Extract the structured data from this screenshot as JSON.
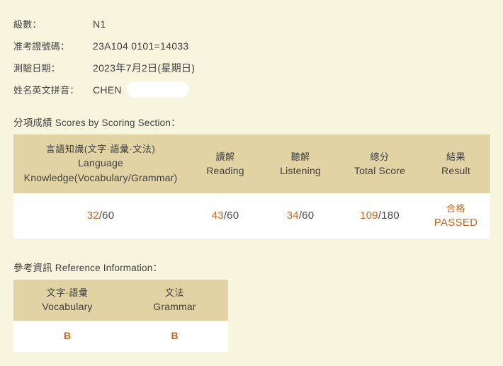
{
  "info": {
    "rows": [
      {
        "label": "級數：",
        "value": "N1"
      },
      {
        "label": "准考證號碼：",
        "value": "23A104 0101=14033"
      },
      {
        "label": "測驗日期：",
        "value": "2023年7月2日(星期日)"
      },
      {
        "label": "姓名英文拼音：",
        "value": "CHEN",
        "redacted": true
      }
    ]
  },
  "scores_section": {
    "caption": "分項成績 Scores by Scoring Section：",
    "columns": [
      {
        "cn": "言語知識(文字·語彙·文法)",
        "en_line1": "Language",
        "en_line2": "Knowledge(Vocabulary/Grammar)"
      },
      {
        "cn": "讀解",
        "en_line1": "Reading"
      },
      {
        "cn": "聽解",
        "en_line1": "Listening"
      },
      {
        "cn": "總分",
        "en_line1": "Total Score"
      },
      {
        "cn": "結果",
        "en_line1": "Result"
      }
    ],
    "values": [
      {
        "num": "32",
        "den": "/60"
      },
      {
        "num": "43",
        "den": "/60"
      },
      {
        "num": "34",
        "den": "/60"
      },
      {
        "num": "109",
        "den": "/180"
      }
    ],
    "result": {
      "cn": "合格",
      "en": "PASSED"
    }
  },
  "reference_section": {
    "caption": "參考資訊 Reference Information：",
    "columns": [
      {
        "cn": "文字·語彙",
        "en": "Vocabulary"
      },
      {
        "cn": "文法",
        "en": "Grammar"
      }
    ],
    "grades": [
      "B",
      "B"
    ]
  },
  "colors": {
    "page_background": "#f7f5dd",
    "header_cell": "#e2d3a5",
    "accent_orange": "#c8651b",
    "body_text": "#3f3f3f",
    "cell_background": "#ffffff"
  }
}
